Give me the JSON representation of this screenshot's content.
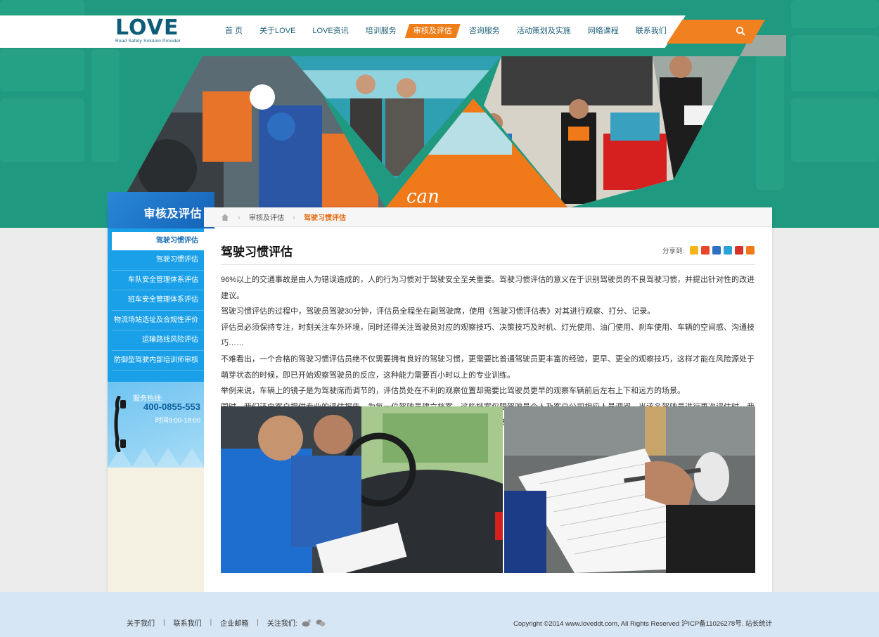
{
  "brand": {
    "logo_text": "LOVE",
    "tagline": "Road Safety Solution Provider"
  },
  "nav": {
    "items": [
      {
        "label": "首 页"
      },
      {
        "label": "关于LOVE"
      },
      {
        "label": "LOVE资讯"
      },
      {
        "label": "培训服务"
      },
      {
        "label": "审核及评估",
        "active": true
      },
      {
        "label": "咨询服务"
      },
      {
        "label": "活动策划及实施"
      },
      {
        "label": "网络课程"
      },
      {
        "label": "联系我们"
      }
    ],
    "search_icon": "search-icon"
  },
  "sidebar": {
    "title": "审核及评估",
    "items": [
      {
        "label": "驾驶习惯评估",
        "active": true
      },
      {
        "label": "驾驶习惯评估"
      },
      {
        "label": "车队安全管理体系评估"
      },
      {
        "label": "班车安全管理体系评估"
      },
      {
        "label": "物流场站选址及合规性评价"
      },
      {
        "label": "运输路线风险评估"
      },
      {
        "label": "防御型驾驶内部培训师审核"
      }
    ],
    "hotline_label": "服务热线:",
    "hotline_number": "400-0855-553",
    "hotline_hours": "时间9:00-18:00"
  },
  "breadcrumb": {
    "section": "审核及评估",
    "current": "驾驶习惯评估"
  },
  "article": {
    "title": "驾驶习惯评估",
    "share_label": "分享到:",
    "paragraphs": [
      "96%以上的交通事故是由人为错误造成的，人的行为习惯对于驾驶安全至关重要。驾驶习惯评估的意义在于识别驾驶员的不良驾驶习惯，并提出针对性的改进建议。",
      "驾驶习惯评估的过程中，驾驶员驾驶30分钟，评估员全程坐在副驾驶席，使用《驾驶习惯评估表》对其进行观察、打分、记录。",
      "评估员必须保持专注，时刻关注车外环境，同时还得关注驾驶员对应的观察技巧、决策技巧及时机、灯光使用、油门使用、刹车使用、车辆的空间感、沟通技巧……",
      "不难看出，一个合格的驾驶习惯评估员绝不仅需要拥有良好的驾驶习惯，更需要比普通驾驶员更丰富的经验，更早、更全的观察技巧，这样才能在风险源处于萌芽状态的时候，即已开始观察驾驶员的反应，这种能力需要百小时以上的专业训练。",
      "举例来说，车辆上的镜子是为驾驶席而调节的，评估员处在不利的观察位置却需要比驾驶员更早的观察车辆前后左右上下和远方的场景。",
      "同时，我们还向客户提供专业的评估报告，为每一位驾驶员建立档案，这些档案仅限驾驶员个人及客户公司相应人员调阅。当该名驾驶员进行再次评估时，我们对其驾驶行为习惯对比分析，观察培训成效。若干年后，您依然可以轻松查询到该驾驶员的原始培训、评估记录，了解其持续改进轨迹。"
    ]
  },
  "footer": {
    "links": [
      "关于我们",
      "联系我们",
      "企业邮箱"
    ],
    "follow_label": "关注我们:",
    "copyright": "Copyright ©2014 www.loveddt.com, All Rights Reserved 沪ICP备11026278号.  站长统计"
  },
  "colors": {
    "teal": "#1f9a80",
    "orange": "#ef7d18",
    "blue": "#1aa0e8",
    "navy": "#0d5d78"
  }
}
